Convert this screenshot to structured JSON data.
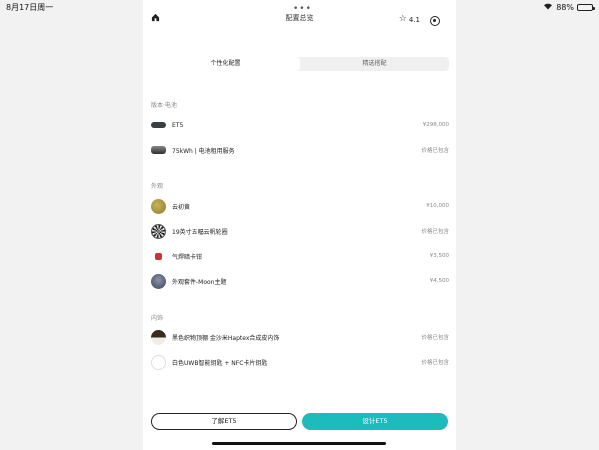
{
  "status_bar": {
    "time": "8月17日周一",
    "battery": "88%",
    "battery_level": 0.88,
    "wifi_icon": "wifi-icon"
  },
  "header": {
    "title": "配置总览",
    "rating": "4.1",
    "home_icon": "home-icon",
    "star_icon": "star-icon",
    "target_icon": "target-icon"
  },
  "tabs": [
    {
      "label": "个性化配置",
      "active": true
    },
    {
      "label": "精选搭配",
      "active": false
    }
  ],
  "sections": [
    {
      "label": "版本·电池",
      "items": [
        {
          "name": "ET5",
          "price": "¥298,000",
          "thumb": "car"
        },
        {
          "name": "75kWh | 电池租用服务",
          "price": "价格已包含",
          "thumb": "battery-pack"
        }
      ]
    },
    {
      "label": "外观",
      "items": [
        {
          "name": "云初黄",
          "price": "¥10,000",
          "thumb": "paint-gold"
        },
        {
          "name": "19英寸五幅云帆轮圈",
          "price": "价格已包含",
          "thumb": "wheel"
        },
        {
          "name": "气焊暗卡钳",
          "price": "¥3,500",
          "thumb": "caliper"
        },
        {
          "name": "外观套件-Moon主题",
          "price": "¥4,500",
          "thumb": "moon-kit"
        }
      ]
    },
    {
      "label": "内饰",
      "items": [
        {
          "name": "黑色织物顶棚 金沙米Haptex合成皮内饰",
          "price": "价格已包含",
          "thumb": "interior"
        },
        {
          "name": "白色UWB智能钥匙 + NFC卡片钥匙",
          "price": "价格已包含",
          "thumb": "key"
        }
      ]
    }
  ],
  "actions": {
    "learn": "了解ET5",
    "design": "设计ET5"
  },
  "colors": {
    "accent": "#1dbcbc"
  }
}
